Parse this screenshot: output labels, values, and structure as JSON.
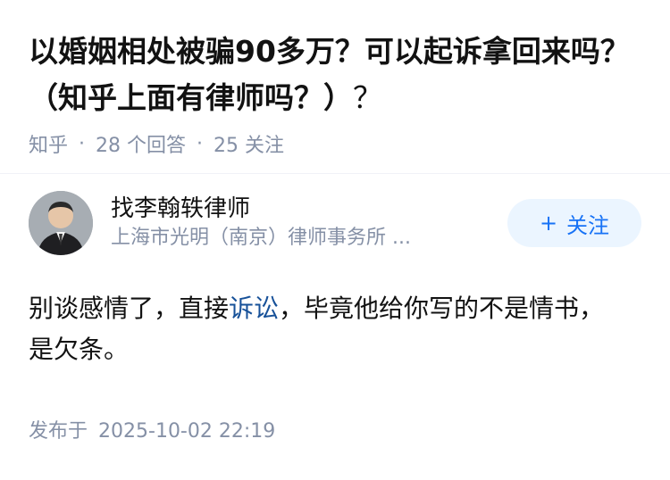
{
  "question": {
    "title": "以婚姻相处被骗90多万？可以起诉拿回来吗？（知乎上面有律师吗？）",
    "title_tail": "？",
    "source": "知乎",
    "answers_count": "28 个回答",
    "followers_count": "25 关注"
  },
  "answer": {
    "author_name": "找李翰轶律师",
    "author_org": "上海市光明（南京）律师事务所 ...",
    "follow_label": "关注",
    "follow_icon": "plus-icon",
    "body_before": "别谈感情了，直接",
    "body_link": "诉讼",
    "body_after": "，毕竟他给你写的不是情书，是欠条。",
    "publish_label": "发布于",
    "publish_time": "2025-10-02 22:19"
  },
  "colors": {
    "accent": "#1772f6",
    "link": "#175199",
    "meta_gray": "#8590a6",
    "follow_bg": "#ebf5ff"
  }
}
